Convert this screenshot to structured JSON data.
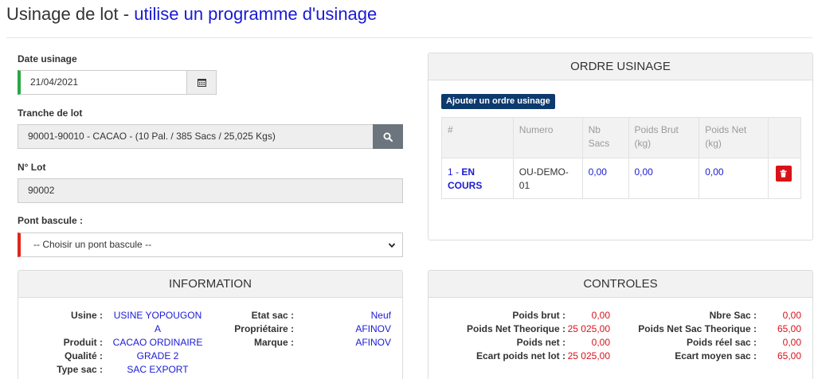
{
  "header": {
    "title": "Usinage de lot -",
    "subtitle": "utilise un programme d'usinage"
  },
  "form": {
    "date_label": "Date usinage",
    "date_value": "21/04/2021",
    "tranche_label": "Tranche de lot",
    "tranche_value": "90001-90010 - CACAO - (10 Pal. / 385 Sacs / 25,025 Kgs)",
    "lot_label": "N° Lot",
    "lot_value": "90002",
    "pont_label": "Pont bascule :",
    "pont_selected": "-- Choisir un pont bascule --"
  },
  "ordre": {
    "title": "ORDRE USINAGE",
    "add_label": "Ajouter un ordre usinage",
    "columns": [
      "#",
      "Numero",
      "Nb Sacs",
      "Poids Brut (kg)",
      "Poids Net (kg)"
    ],
    "rows": [
      {
        "index": "1 -",
        "status": "EN COURS",
        "numero": "OU-DEMO-01",
        "nb_sacs": "0,00",
        "poids_brut": "0,00",
        "poids_net": "0,00"
      }
    ]
  },
  "information": {
    "title": "INFORMATION",
    "usine_label": "Usine :",
    "usine_value": "USINE YOPOUGON A",
    "produit_label": "Produit :",
    "produit_value": "CACAO ORDINAIRE",
    "qualite_label": "Qualité :",
    "qualite_value": "GRADE 2",
    "type_sac_label": "Type sac :",
    "type_sac_value": "SAC EXPORT",
    "etat_sac_label": "Etat sac :",
    "etat_sac_value": "Neuf",
    "proprietaire_label": "Propriétaire :",
    "proprietaire_value": "AFINOV",
    "marque_label": "Marque :",
    "marque_value": "AFINOV"
  },
  "controles": {
    "title": "CONTROLES",
    "poids_brut_label": "Poids brut :",
    "poids_brut_value": "0,00",
    "poids_net_theo_label": "Poids Net Theorique :",
    "poids_net_theo_value": "25 025,00",
    "poids_net_label": "Poids net :",
    "poids_net_value": "0,00",
    "ecart_lot_label": "Ecart poids net lot :",
    "ecart_lot_value": "25 025,00",
    "nbre_sac_label": "Nbre Sac :",
    "nbre_sac_value": "0,00",
    "poids_net_sac_theo_label": "Poids Net Sac Theorique :",
    "poids_net_sac_theo_value": "65,00",
    "poids_reel_sac_label": "Poids réel sac :",
    "poids_reel_sac_value": "0,00",
    "ecart_moyen_label": "Ecart moyen sac :",
    "ecart_moyen_value": "65,00"
  },
  "colors": {
    "accent_blue": "#1a1ad6",
    "button_navy": "#0d3a6e",
    "required_red": "#e0261b",
    "valid_green": "#27a844",
    "value_red": "#d9121a"
  },
  "icons": {
    "calendar": "calendar-icon",
    "search": "search-icon",
    "chevron": "chevron-down-icon",
    "delete": "trash-icon"
  }
}
